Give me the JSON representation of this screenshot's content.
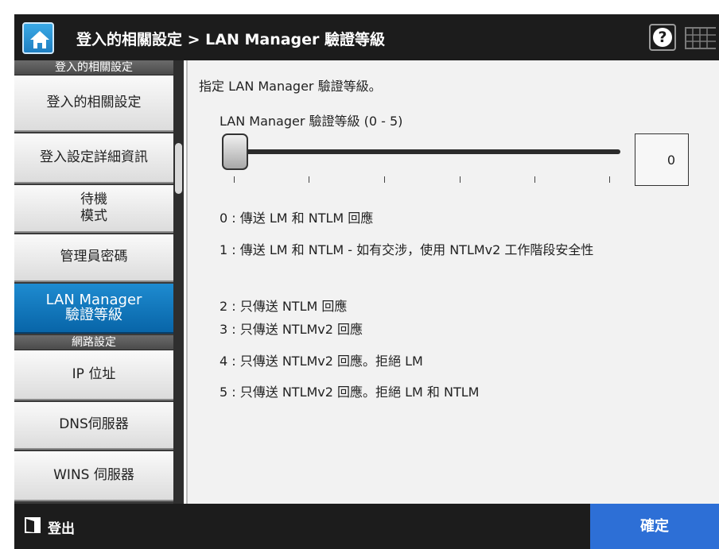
{
  "header": {
    "title": "登入的相關設定 > LAN Manager 驗證等級",
    "help_symbol": "?"
  },
  "sidebar": {
    "sections": [
      {
        "header": "登入的相關設定",
        "items": [
          {
            "label": "登入的相關設定"
          },
          {
            "label": "登入設定詳細資訊"
          },
          {
            "label": "待機\n模式"
          },
          {
            "label": "管理員密碼"
          },
          {
            "label": "LAN Manager\n驗證等級",
            "active": true
          }
        ]
      },
      {
        "header": "網路設定",
        "items": [
          {
            "label": "IP 位址"
          },
          {
            "label": "DNS伺服器"
          },
          {
            "label": "WINS 伺服器"
          }
        ]
      }
    ]
  },
  "content": {
    "instruction": "指定 LAN Manager 驗證等級。",
    "slider": {
      "label": "LAN Manager 驗證等級 (0 - 5)",
      "min": 0,
      "max": 5,
      "value": 0,
      "value_display": "0"
    },
    "levels": [
      "0 : 傳送 LM 和 NTLM 回應",
      "1 : 傳送 LM 和 NTLM - 如有交涉，使用 NTLMv2 工作階段安全性",
      "2 : 只傳送 NTLM 回應",
      "3 : 只傳送 NTLMv2 回應",
      "4 : 只傳送 NTLMv2 回應。拒絕 LM",
      "5 : 只傳送 NTLMv2 回應。拒絕 LM 和 NTLM"
    ]
  },
  "footer": {
    "logout_label": "登出",
    "ok_label": "確定"
  },
  "colors": {
    "header_bg": "#1c1c1c",
    "active_item": "#0a75bd",
    "ok_button": "#2d6fd6",
    "content_bg": "#f2f2f2"
  },
  "icons": {
    "home": "home-icon",
    "help": "question-icon",
    "keyboard": "keyboard-icon",
    "logout": "logout-door-icon"
  }
}
